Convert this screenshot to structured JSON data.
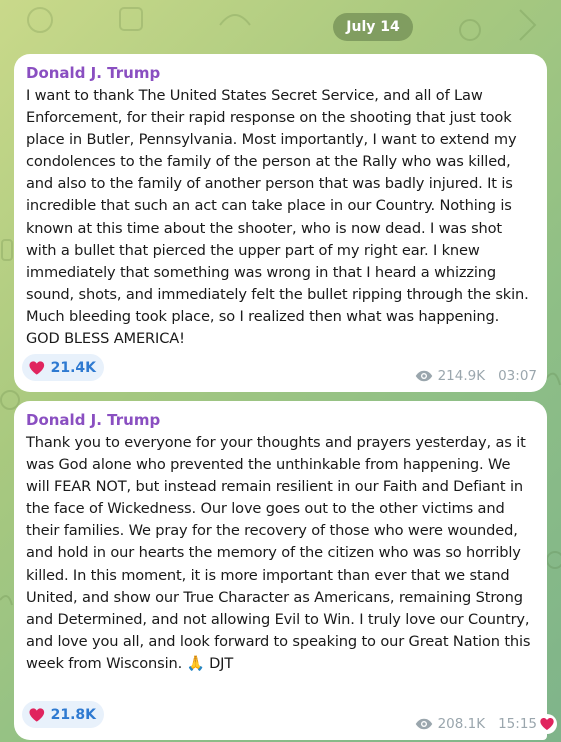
{
  "date_separator": "July 14",
  "messages": [
    {
      "author": "Donald J. Trump",
      "text": "I want to thank The United States Secret Service, and all of Law Enforcement, for their rapid response on the shooting that just took place in Butler, Pennsylvania. Most importantly, I want to extend my condolences to the family of the person at the Rally who was killed, and also to the family of another person that was badly injured. It is incredible that such an act can take place in our Country. Nothing is known at this time about the shooter, who is now dead. I was shot with a bullet that pierced the upper part of my right ear. I knew immediately that something was wrong in that I heard a whizzing sound, shots, and immediately felt the bullet ripping through the skin. Much bleeding took place, so I realized then what was happening. GOD BLESS AMERICA!",
      "reaction_icon": "red-heart-icon",
      "reaction_count": "21.4K",
      "views_icon": "eye-icon",
      "views": "214.9K",
      "time": "03:07"
    },
    {
      "author": "Donald J. Trump",
      "text": "Thank you to everyone for your thoughts and prayers yesterday, as it was God alone who prevented the unthinkable from happening. We will FEAR NOT, but instead remain resilient in our Faith and Defiant in the face of Wickedness. Our love goes out to the other victims and their families. We pray for the recovery of those who were wounded, and hold in our hearts the memory of the citizen who was so horribly killed. In this moment, it is more important than ever that we stand United, and show our True Character as Americans, remaining Strong and Determined, and not allowing Evil to Win. I truly love our Country, and love you all, and look forward to speaking to our Great Nation this week from Wisconsin. 🙏 DJT",
      "reaction_icon": "red-heart-icon",
      "reaction_count": "21.8K",
      "views_icon": "eye-icon",
      "views": "208.1K",
      "time": "15:15"
    }
  ],
  "colors": {
    "author": "#8a4fc1",
    "reaction_bg": "#e8f1fb",
    "reaction_text": "#2f7ad1",
    "heart": "#e0245e",
    "meta_text": "#9aa6ad"
  },
  "corner_icon": "red-heart-icon"
}
